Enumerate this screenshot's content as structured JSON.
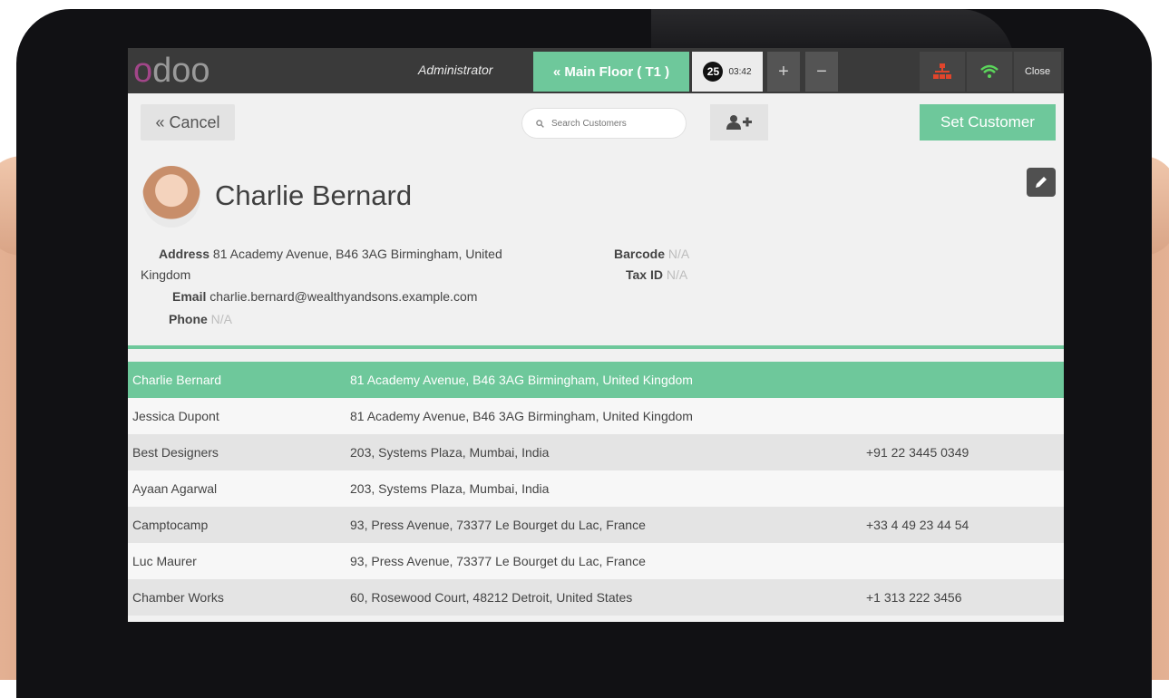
{
  "app": {
    "logo": "odoo",
    "user": "Administrator",
    "floor_button": "« Main Floor ( T1 )",
    "order": {
      "number": "25",
      "time": "03:42"
    },
    "add_order_symbol": "+",
    "remove_order_symbol": "−",
    "close_label": "Close",
    "icons": [
      "sitemap-icon",
      "wifi-icon"
    ],
    "colors": {
      "accent": "#6ec89b",
      "topbar": "#3a3a3a",
      "logo_o": "#a24689"
    }
  },
  "controls": {
    "cancel_label": "« Cancel",
    "search_placeholder": "Search Customers",
    "set_customer_label": "Set Customer"
  },
  "customer": {
    "name": "Charlie Bernard",
    "address_label": "Address",
    "address_line1": "81 Academy Avenue, B46 3AG Birmingham, United",
    "address_line2": "Kingdom",
    "email_label": "Email",
    "email": "charlie.bernard@wealthyandsons.example.com",
    "phone_label": "Phone",
    "phone": "N/A",
    "barcode_label": "Barcode",
    "barcode": "N/A",
    "taxid_label": "Tax ID",
    "taxid": "N/A"
  },
  "list": [
    {
      "name": "Charlie Bernard",
      "address": "81 Academy Avenue, B46 3AG Birmingham, United Kingdom",
      "phone": "",
      "selected": true
    },
    {
      "name": "Jessica Dupont",
      "address": "81 Academy Avenue, B46 3AG Birmingham, United Kingdom",
      "phone": ""
    },
    {
      "name": "Best Designers",
      "address": "203, Systems Plaza, Mumbai, India",
      "phone": "+91 22 3445 0349"
    },
    {
      "name": "Ayaan Agarwal",
      "address": "203, Systems Plaza, Mumbai, India",
      "phone": ""
    },
    {
      "name": "Camptocamp",
      "address": "93, Press Avenue, 73377 Le Bourget du Lac, France",
      "phone": "+33 4 49 23 44 54"
    },
    {
      "name": "Luc Maurer",
      "address": "93, Press Avenue, 73377 Le Bourget du Lac, France",
      "phone": ""
    },
    {
      "name": "Chamber Works",
      "address": "60, Rosewood Court, 48212 Detroit, United States",
      "phone": "+1 313 222 3456"
    }
  ]
}
